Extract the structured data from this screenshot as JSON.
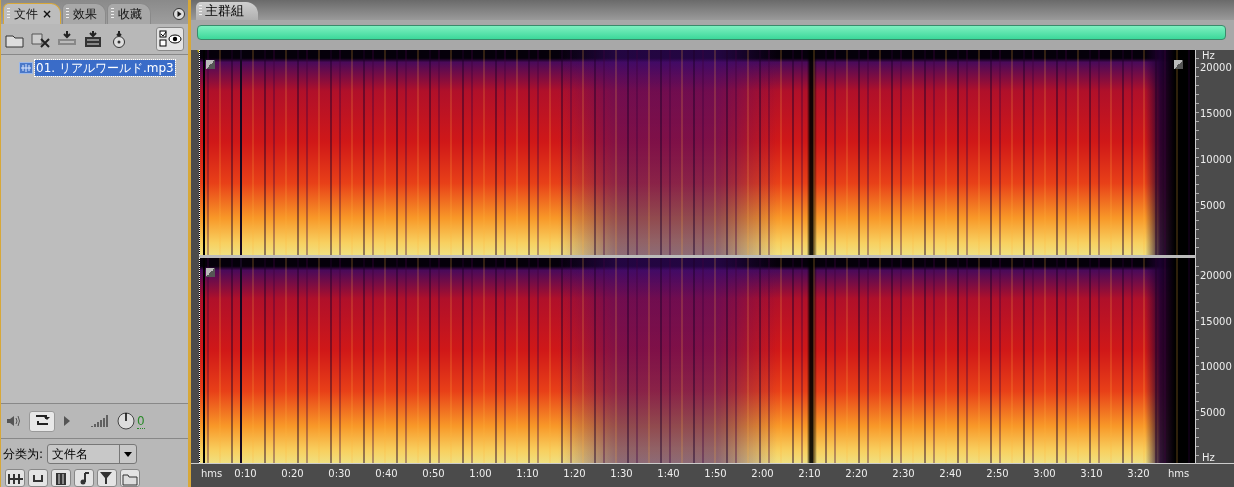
{
  "left_panel": {
    "tabs": [
      {
        "label": "文件",
        "selected": true,
        "close": "×"
      },
      {
        "label": "效果",
        "selected": false
      },
      {
        "label": "收藏",
        "selected": false
      }
    ],
    "files": [
      {
        "name": "01. リアルワールド.mp3",
        "selected": true
      }
    ],
    "volume_reading": "0",
    "sort_label": "分类为:",
    "sort_value": "文件名"
  },
  "editor": {
    "tab": "主群組",
    "channels": [
      {
        "unit_top": "Hz",
        "ticks": [
          "20000",
          "15000",
          "10000",
          "5000"
        ]
      },
      {
        "unit_bottom": "Hz",
        "ticks": [
          "20000",
          "15000",
          "10000",
          "5000"
        ]
      }
    ],
    "time_ruler": {
      "unit": "hms",
      "ticks": [
        "0:10",
        "0:20",
        "0:30",
        "0:40",
        "0:50",
        "1:00",
        "1:10",
        "1:20",
        "1:30",
        "1:40",
        "1:50",
        "2:00",
        "2:10",
        "2:20",
        "2:30",
        "2:40",
        "2:50",
        "3:00",
        "3:10",
        "3:20"
      ],
      "end_unit": "hms"
    }
  }
}
